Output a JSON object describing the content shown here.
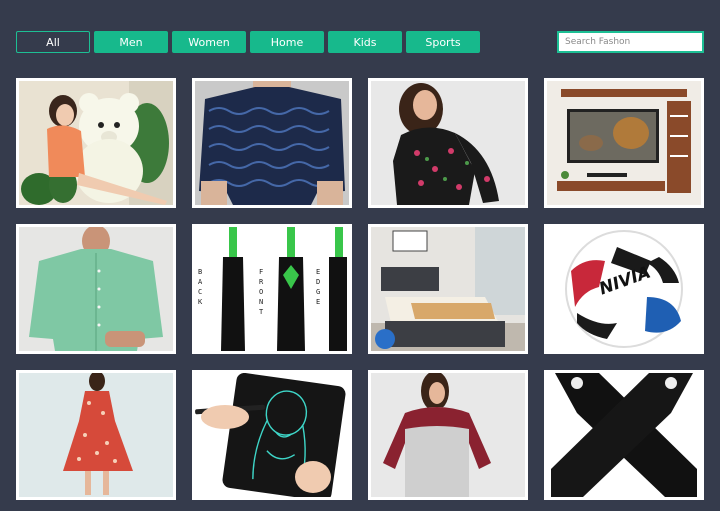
{
  "filters": [
    {
      "label": "All",
      "active": true
    },
    {
      "label": "Men",
      "active": false
    },
    {
      "label": "Women",
      "active": false
    },
    {
      "label": "Home",
      "active": false
    },
    {
      "label": "Kids",
      "active": false
    },
    {
      "label": "Sports",
      "active": false
    }
  ],
  "search": {
    "placeholder": "Search Fashon",
    "value": ""
  },
  "products": [
    {
      "image": "teddy-bear-with-girl-photo"
    },
    {
      "image": "patterned-mens-shirt-photo"
    },
    {
      "image": "floral-womens-top-photo"
    },
    {
      "image": "tv-wall-unit-photo"
    },
    {
      "image": "mint-green-mens-shirt-photo"
    },
    {
      "image": "cricket-bat-photo",
      "bat_text": [
        "BACK",
        "FRONT",
        "EDGE"
      ]
    },
    {
      "image": "bed-with-storage-photo"
    },
    {
      "image": "football-photo",
      "ball_brand": "NIVIA"
    },
    {
      "image": "floral-dress-photo"
    },
    {
      "image": "drawing-tablet-photo"
    },
    {
      "image": "raglan-tshirt-photo"
    },
    {
      "image": "arm-sleeves-photo"
    }
  ],
  "colors": {
    "background": "#353b4c",
    "accent": "#17b98c",
    "card": "#ffffff"
  }
}
